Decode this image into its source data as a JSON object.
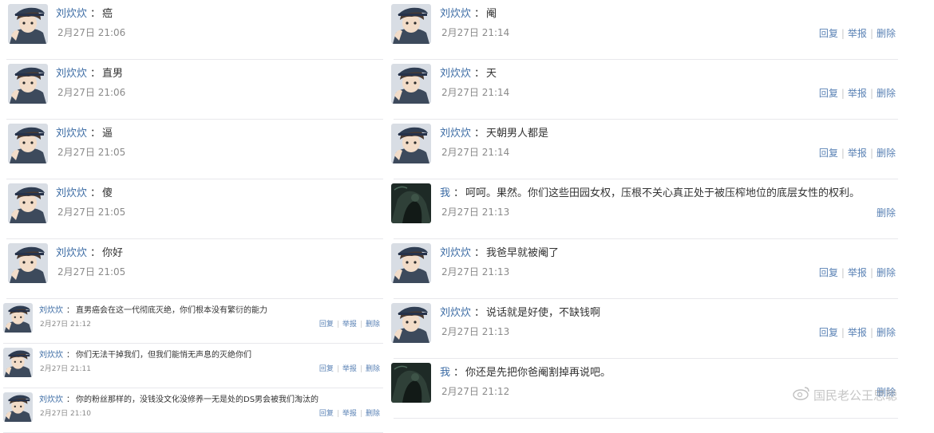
{
  "left_large": [
    {
      "user": "刘炊炊",
      "sep": "：",
      "text": "癌",
      "date": "2月27日 21:06"
    },
    {
      "user": "刘炊炊",
      "sep": "：",
      "text": "直男",
      "date": "2月27日 21:06"
    },
    {
      "user": "刘炊炊",
      "sep": "：",
      "text": "逼",
      "date": "2月27日 21:05"
    },
    {
      "user": "刘炊炊",
      "sep": "：",
      "text": "傻",
      "date": "2月27日 21:05"
    },
    {
      "user": "刘炊炊",
      "sep": "：",
      "text": "你好",
      "date": "2月27日 21:05"
    }
  ],
  "left_small": [
    {
      "user": "刘炊炊",
      "sep": "：",
      "text": "直男癌会在这一代彻底灭绝，你们根本没有繁衍的能力",
      "date": "2月27日 21:12",
      "reply": "回复",
      "report": "举报",
      "delete": "删除"
    },
    {
      "user": "刘炊炊",
      "sep": "：",
      "text": "你们无法干掉我们，但我们能悄无声息的灭绝你们",
      "date": "2月27日 21:11",
      "reply": "回复",
      "report": "举报",
      "delete": "删除"
    },
    {
      "user": "刘炊炊",
      "sep": "：",
      "text": "你的粉丝那样的，没钱没文化没修养一无是处的DS男会被我们淘汰的",
      "date": "2月27日 21:10",
      "reply": "回复",
      "report": "举报",
      "delete": "删除"
    }
  ],
  "right": [
    {
      "user": "刘炊炊",
      "sep": "：",
      "text": "阉",
      "date": "2月27日 21:14",
      "reply": "回复",
      "report": "举报",
      "delete": "删除",
      "avatar": "anime"
    },
    {
      "user": "刘炊炊",
      "sep": "：",
      "text": "天",
      "date": "2月27日 21:14",
      "reply": "回复",
      "report": "举报",
      "delete": "删除",
      "avatar": "anime"
    },
    {
      "user": "刘炊炊",
      "sep": "：",
      "text": "天朝男人都是",
      "date": "2月27日 21:14",
      "reply": "回复",
      "report": "举报",
      "delete": "删除",
      "avatar": "anime"
    },
    {
      "user": "我",
      "sep": "：",
      "text": "呵呵。果然。你们这些田园女权，压根不关心真正处于被压榨地位的底层女性的权利。",
      "date": "2月27日 21:13",
      "delete": "删除",
      "avatar": "dark"
    },
    {
      "user": "刘炊炊",
      "sep": "：",
      "text": "我爸早就被阉了",
      "date": "2月27日 21:13",
      "reply": "回复",
      "report": "举报",
      "delete": "删除",
      "avatar": "anime"
    },
    {
      "user": "刘炊炊",
      "sep": "：",
      "text": "说话就是好使，不缺钱啊",
      "date": "2月27日 21:13",
      "reply": "回复",
      "report": "举报",
      "delete": "删除",
      "avatar": "anime"
    },
    {
      "user": "我",
      "sep": "：",
      "text": "你还是先把你爸阉割掉再说吧。",
      "date": "2月27日 21:12",
      "delete": "删除",
      "avatar": "dark"
    }
  ],
  "watermark": "国民老公王思聪",
  "colors": {
    "username": "#3a6aa3",
    "action_link": "#5a82b5",
    "meta": "#8a8a8a",
    "divider": "#e8e8ec"
  },
  "icons": {
    "watermark": "weibo-logo-icon",
    "avatar_anime": "anime-avatar-icon",
    "avatar_dark": "dark-avatar-icon"
  }
}
